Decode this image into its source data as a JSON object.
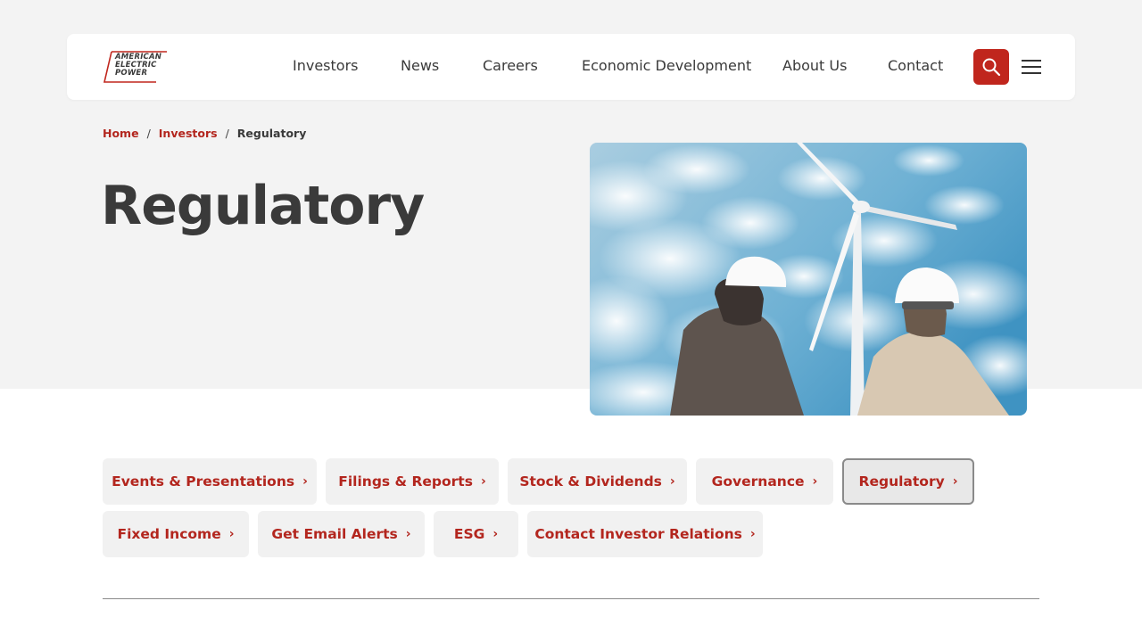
{
  "logo": {
    "lines": [
      "AMERICAN",
      "ELECTRIC",
      "POWER"
    ],
    "accent_color": "#c0261d"
  },
  "nav": {
    "items": [
      {
        "label": "Investors"
      },
      {
        "label": "News"
      },
      {
        "label": "Careers"
      },
      {
        "label": "Economic Development"
      },
      {
        "label": "About Us"
      },
      {
        "label": "Contact"
      }
    ],
    "search_icon": "search-icon",
    "menu_icon": "hamburger-menu-icon"
  },
  "breadcrumb": {
    "items": [
      {
        "label": "Home"
      },
      {
        "label": "Investors"
      }
    ],
    "separator": "/",
    "current": "Regulatory"
  },
  "page": {
    "title": "Regulatory"
  },
  "links": {
    "chevron": "›",
    "items": [
      {
        "label": "Events & Presentations",
        "active": false
      },
      {
        "label": "Filings & Reports",
        "active": false
      },
      {
        "label": "Stock & Dividends",
        "active": false
      },
      {
        "label": "Governance",
        "active": false
      },
      {
        "label": "Regulatory",
        "active": true
      },
      {
        "label": "Fixed Income",
        "active": false
      },
      {
        "label": "Get Email Alerts",
        "active": false
      },
      {
        "label": "ESG",
        "active": false
      },
      {
        "label": "Contact Investor Relations",
        "active": false
      }
    ]
  },
  "colors": {
    "brand_red": "#b3261e",
    "search_bg": "#c0261d",
    "hero_bg": "#f3f3f3",
    "text_dark": "#3a3a3a"
  }
}
